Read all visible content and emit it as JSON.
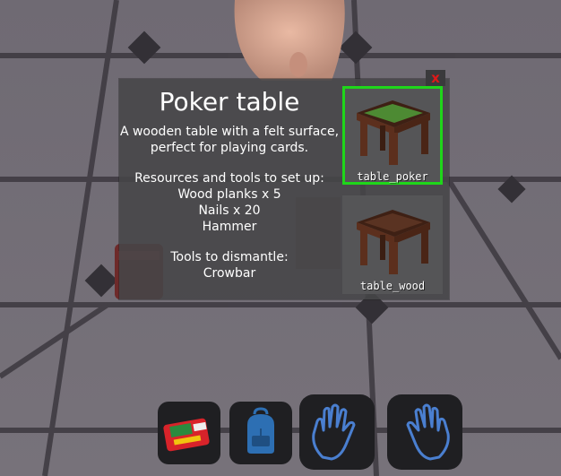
{
  "panel": {
    "title": "Poker table",
    "description": [
      "A wooden table with a felt surface,",
      "perfect for playing cards."
    ],
    "setup_heading": "Resources and tools to set up:",
    "setup_items": [
      "Wood planks x 5",
      "Nails x 20",
      "Hammer"
    ],
    "dismantle_heading": "Tools to dismantle:",
    "dismantle_items": [
      "Crowbar"
    ],
    "close_icon": "x"
  },
  "variants": [
    {
      "label": "table_poker",
      "selected": true,
      "top_color": "#4d8a33"
    },
    {
      "label": "table_wood",
      "selected": false,
      "top_color": "#5a3322"
    }
  ],
  "hotbar": {
    "slots": [
      {
        "icon": "radio-device-icon"
      },
      {
        "icon": "backpack-icon"
      },
      {
        "icon": "left-hand-icon"
      },
      {
        "icon": "right-hand-icon"
      }
    ]
  },
  "colors": {
    "selection_border": "#1fd61a",
    "close_icon": "#e01818",
    "hand_outline": "#4a7fd0"
  }
}
